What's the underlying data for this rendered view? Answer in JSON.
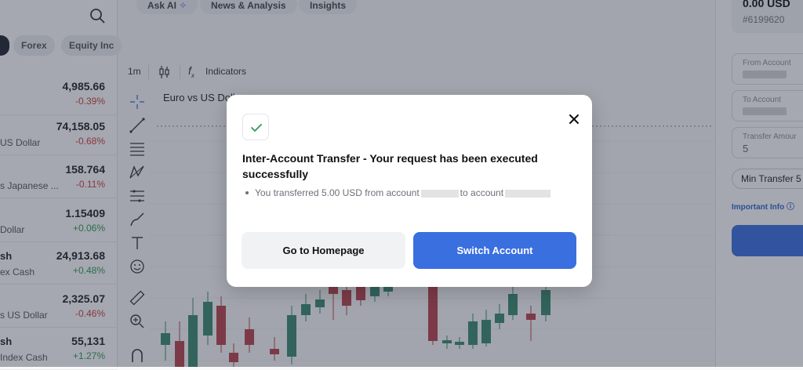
{
  "header_tabs": [
    "Ask AI",
    "News & Analysis",
    "Insights"
  ],
  "market_filters": [
    "Forex",
    "Equity Inc"
  ],
  "markets": [
    {
      "name": "",
      "sub": "",
      "price": "4,985.66",
      "change": "-0.39%",
      "dir": "neg"
    },
    {
      "name": "",
      "sub": "US Dollar",
      "price": "74,158.05",
      "change": "-0.68%",
      "dir": "neg"
    },
    {
      "name": "",
      "sub": "s Japanese ...",
      "price": "158.764",
      "change": "-0.11%",
      "dir": "neg"
    },
    {
      "name": "",
      "sub": "Dollar",
      "price": "1.15409",
      "change": "+0.06%",
      "dir": "pos"
    },
    {
      "name": "sh",
      "sub": "ex Cash",
      "price": "24,913.68",
      "change": "+0.48%",
      "dir": "pos"
    },
    {
      "name": "",
      "sub": "s US Dollar",
      "price": "2,325.07",
      "change": "-0.46%",
      "dir": "neg"
    },
    {
      "name": "sh",
      "sub": "Index Cash",
      "price": "55,131",
      "change": "+1.27%",
      "dir": "pos"
    }
  ],
  "chart": {
    "timeframe": "1m",
    "indicators_label": "Indicators",
    "title": "Euro vs US Dolla",
    "up_color": "#3a8a6d",
    "down_color": "#b8434c",
    "tools": [
      "crosshair-icon",
      "trend-line-icon",
      "fib-icon",
      "pattern-icon",
      "measure-lines-icon",
      "brush-icon",
      "text-icon",
      "emoji-icon",
      "ruler-icon",
      "zoom-icon",
      "magnet-icon"
    ]
  },
  "right_panel": {
    "balance": "0.00 USD",
    "account_id": "#6199620",
    "from_label": "From Account",
    "to_label": "To Account",
    "amount_label": "Transfer Amour",
    "amount_value": "5",
    "min_transfer": "Min Transfer 5",
    "important_info": "Important Info",
    "accent": "#3a6fe0"
  },
  "modal": {
    "title": "Inter-Account Transfer - Your request has been executed successfully",
    "msg_prefix": "You transferred 5.00 USD from account",
    "msg_middle": "to account",
    "btn_home": "Go to Homepage",
    "btn_switch": "Switch Account",
    "success_color": "#2d9a55"
  }
}
